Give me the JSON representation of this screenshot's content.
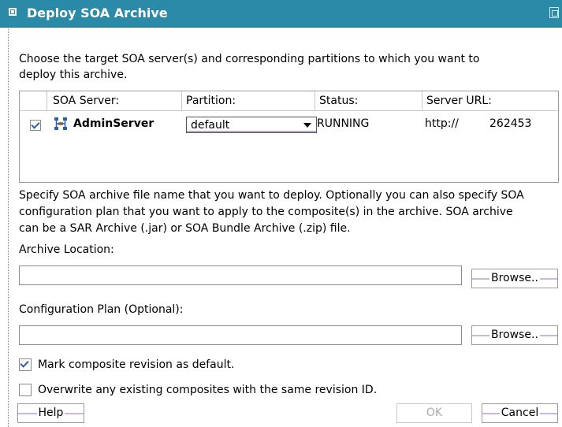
{
  "window": {
    "title": "Deploy SOA Archive"
  },
  "intro_text": {
    "line1": "Choose the target SOA server(s) and corresponding partitions to which you want to",
    "line2": "deploy this archive."
  },
  "servers_table": {
    "columns": [
      "SOA Server:",
      "Partition:",
      "Status:",
      "Server URL:"
    ],
    "rows": [
      {
        "selected": true,
        "server": "AdminServer",
        "partition": "default",
        "status": "RUNNING",
        "url_prefix": "http://",
        "url_suffix": "262453"
      }
    ]
  },
  "archive_text": {
    "line1": "Specify SOA archive file name that you want to deploy. Optionally you can also specify SOA",
    "line2": "configuration plan that you want to apply to the composite(s) in the archive. SOA archive",
    "line3": "can be a SAR Archive (.jar) or SOA Bundle Archive (.zip) file."
  },
  "archive_location": {
    "label": "Archive Location:",
    "value": "",
    "browse_label": "Browse.."
  },
  "config_plan": {
    "label": "Configuration Plan (Optional):",
    "value": "",
    "browse_label": "Browse.."
  },
  "options": {
    "mark_default": {
      "label": "Mark composite revision as default.",
      "checked": true
    },
    "overwrite": {
      "label": "Overwrite any existing composites with the same revision ID.",
      "checked": false
    }
  },
  "buttons": {
    "help": "Help",
    "ok": "OK",
    "cancel": "Cancel"
  },
  "icons": {
    "title_bar": "window-menu-icon",
    "restore": "restore-icon",
    "server": "server-icon"
  }
}
